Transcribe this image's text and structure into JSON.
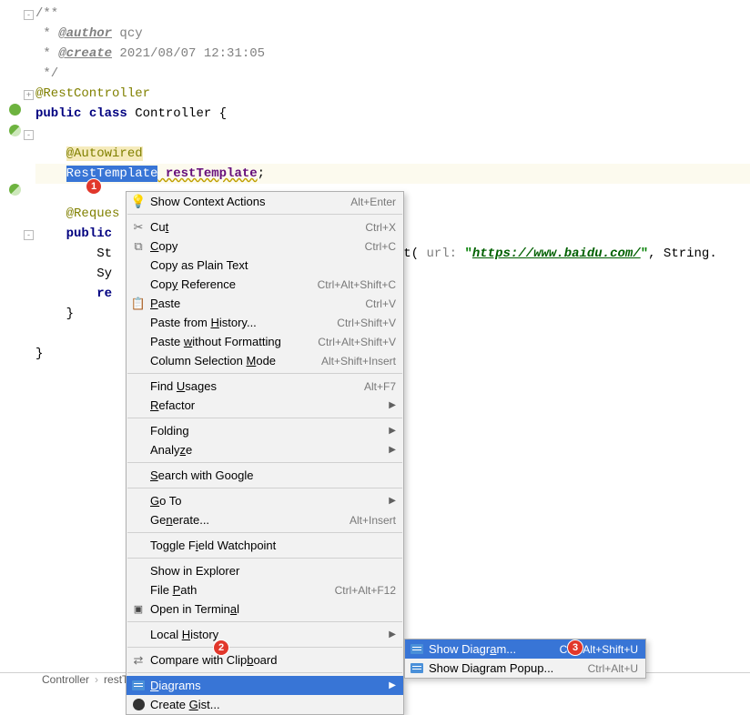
{
  "code": {
    "l1": "/**",
    "l2_prefix": " * ",
    "l2_tag": "@author",
    "l2_after": " qcy",
    "l3_prefix": " * ",
    "l3_tag": "@create",
    "l3_after": " 2021/08/07 12:31:05",
    "l4": " */",
    "l5": "@RestController",
    "l6_part1": "public",
    "l6_part2": " class",
    "l6_part3": " Controller {",
    "l8_ann": "@Autowired",
    "l9_type": "RestTemplate",
    "l9_field": " restTemplate",
    "l9_semicolon": ";",
    "l11_ann": "@Reques",
    "l12_part1": "public",
    "l12_part2": " ",
    "l13": "St",
    "l13_after": "ject( ",
    "l13_param": "url: ",
    "l13_q1": "\"",
    "l13_url": "https://www.baidu.com/",
    "l13_q2": "\"",
    "l13_tail": ", String.",
    "l14": "Sy",
    "l15_kw": "re",
    "l16": "}",
    "l17": "}"
  },
  "menu": {
    "items": [
      {
        "icon": "bulb",
        "label": "Show Context Actions",
        "shortcut": "Alt+Enter"
      },
      {
        "separator": true
      },
      {
        "icon": "cut",
        "label": "Cu<u>t</u>",
        "shortcut": "Ctrl+X"
      },
      {
        "icon": "copy",
        "label": "<u>C</u>opy",
        "shortcut": "Ctrl+C"
      },
      {
        "label": "Copy as Plain Text"
      },
      {
        "label": "Cop<u>y</u> Reference",
        "shortcut": "Ctrl+Alt+Shift+C"
      },
      {
        "icon": "paste",
        "label": "<u>P</u>aste",
        "shortcut": "Ctrl+V"
      },
      {
        "label": "Paste from <u>H</u>istory...",
        "shortcut": "Ctrl+Shift+V"
      },
      {
        "label": "Paste <u>w</u>ithout Formatting",
        "shortcut": "Ctrl+Alt+Shift+V"
      },
      {
        "label": "Column Selection <u>M</u>ode",
        "shortcut": "Alt+Shift+Insert"
      },
      {
        "separator": true
      },
      {
        "label": "Find <u>U</u>sages",
        "shortcut": "Alt+F7"
      },
      {
        "label": "<u>R</u>efactor",
        "arrow": true
      },
      {
        "separator": true
      },
      {
        "label": "Folding",
        "arrow": true
      },
      {
        "label": "Analy<u>z</u>e",
        "arrow": true
      },
      {
        "separator": true
      },
      {
        "label": "<u>S</u>earch with Google"
      },
      {
        "separator": true
      },
      {
        "label": "<u>G</u>o To",
        "arrow": true
      },
      {
        "label": "Ge<u>n</u>erate...",
        "shortcut": "Alt+Insert"
      },
      {
        "separator": true
      },
      {
        "label": "Toggle F<u>i</u>eld Watchpoint"
      },
      {
        "separator": true
      },
      {
        "label": "Show in Explorer"
      },
      {
        "label": "File <u>P</u>ath",
        "shortcut": "Ctrl+Alt+F12"
      },
      {
        "icon": "terminal",
        "label": "Open in Termin<u>a</u>l"
      },
      {
        "separator": true
      },
      {
        "label": "Local <u>H</u>istory",
        "arrow": true
      },
      {
        "separator": true
      },
      {
        "icon": "compare",
        "label": "Compare with Clip<u>b</u>oard"
      },
      {
        "separator": true
      },
      {
        "icon": "diagram",
        "label": "<u>D</u>iagrams",
        "arrow": true,
        "highlighted": true
      },
      {
        "icon": "github",
        "label": "Create <u>G</u>ist..."
      }
    ]
  },
  "submenu": {
    "items": [
      {
        "icon": "diagram",
        "label": "Show Diagr<u>a</u>m...",
        "shortcut": "Ctrl+Alt+Shift+U",
        "highlighted": true
      },
      {
        "icon": "diagram",
        "label": "Show Diagram Popup...",
        "shortcut": "Ctrl+Alt+U"
      }
    ]
  },
  "badges": {
    "b1": "1",
    "b2": "2",
    "b3": "3"
  },
  "footer": {
    "p1": "Controller",
    "sep": "›",
    "p2": "restTemplate"
  }
}
